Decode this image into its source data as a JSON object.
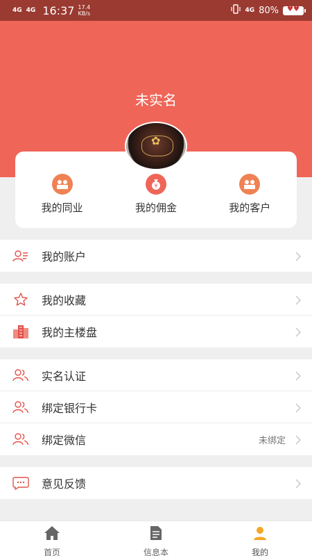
{
  "status_bar": {
    "signal1": "4G",
    "signal2": "4G",
    "time": "16:37",
    "speed_value": "17.4",
    "speed_unit": "KB/s",
    "network": "4G",
    "battery": "80%"
  },
  "profile": {
    "name": "未实名"
  },
  "quick_actions": [
    {
      "label": "我的同业",
      "icon": "peers-icon",
      "color": "#ef8255"
    },
    {
      "label": "我的佣金",
      "icon": "money-bag-icon",
      "color": "#ef6558"
    },
    {
      "label": "我的客户",
      "icon": "customers-icon",
      "color": "#ef8255"
    }
  ],
  "menu_groups": [
    [
      {
        "label": "我的账户",
        "icon": "account-icon",
        "value": ""
      }
    ],
    [
      {
        "label": "我的收藏",
        "icon": "star-icon",
        "value": ""
      },
      {
        "label": "我的主楼盘",
        "icon": "building-icon",
        "value": ""
      }
    ],
    [
      {
        "label": "实名认证",
        "icon": "users-icon",
        "value": ""
      },
      {
        "label": "绑定银行卡",
        "icon": "users-icon",
        "value": ""
      },
      {
        "label": "绑定微信",
        "icon": "users-icon",
        "value": "未绑定"
      }
    ],
    [
      {
        "label": "意见反馈",
        "icon": "feedback-icon",
        "value": ""
      }
    ]
  ],
  "tabs": [
    {
      "label": "首页",
      "icon": "home-icon"
    },
    {
      "label": "信息本",
      "icon": "document-icon"
    },
    {
      "label": "我的",
      "icon": "person-icon",
      "active": true
    }
  ],
  "colors": {
    "accent": "#ef6558",
    "orange": "#ef8255",
    "active_tab": "#f5a623"
  }
}
